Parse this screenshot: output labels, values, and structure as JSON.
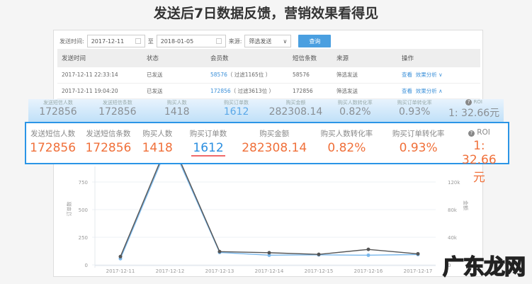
{
  "title": "发送后7日数据反馈，营销效果看得见",
  "filter": {
    "send_time_label": "发送时间:",
    "start": "2017-12-11",
    "to": "至",
    "end": "2018-01-05",
    "source_label": "来源:",
    "source": "筛选发送",
    "query": "查询"
  },
  "table": {
    "headers": [
      "发送时间",
      "状态",
      "会员数",
      "短信条数",
      "来源",
      "操作"
    ],
    "rows": [
      {
        "time": "2017-12-11 22:33:14",
        "status": "已发送",
        "members": "58576",
        "filtered": "（ 过滤1165位 ）",
        "sms": "58576",
        "source": "筛选发送",
        "view": "查看",
        "analysis": "效果分析 ∨"
      },
      {
        "time": "2017-12-11 19:04:20",
        "status": "已发送",
        "members": "172856",
        "filtered": "（ 过滤3613位 ）",
        "sms": "172856",
        "source": "筛选发送",
        "view": "查看",
        "analysis": "效果分析 ∧"
      }
    ]
  },
  "summary": [
    {
      "label": "发送短信人数",
      "value": "172856"
    },
    {
      "label": "发送短信条数",
      "value": "172856"
    },
    {
      "label": "购买人数",
      "value": "1418"
    },
    {
      "label": "购买订单数",
      "value": "1612"
    },
    {
      "label": "购买金额",
      "value": "282308.14"
    },
    {
      "label": "购买人数转化率",
      "value": "0.82%"
    },
    {
      "label": "购买订单转化率",
      "value": "0.93%"
    },
    {
      "label": "ROI",
      "value": "1: 32.66元"
    }
  ],
  "chart_data": {
    "type": "line",
    "categories": [
      "2017-12-11",
      "2017-12-12",
      "2017-12-13",
      "2017-12-14",
      "2017-12-15",
      "2017-12-16",
      "2017-12-17"
    ],
    "ylabel": "订单数",
    "y2label": "金额",
    "yticks": [
      "0",
      "250",
      "500",
      "750"
    ],
    "y2ticks": [
      "0",
      "40k",
      "80k",
      "120k"
    ],
    "series": [
      {
        "name": "订单数",
        "axis": "left",
        "color": "#555555",
        "values": [
          75,
          1150,
          120,
          110,
          95,
          140,
          100
        ]
      },
      {
        "name": "金额",
        "axis": "right",
        "color": "#7ab8ec",
        "values": [
          9000,
          180000,
          18000,
          14000,
          14500,
          14000,
          15000
        ]
      }
    ]
  },
  "watermark": "广东龙网"
}
